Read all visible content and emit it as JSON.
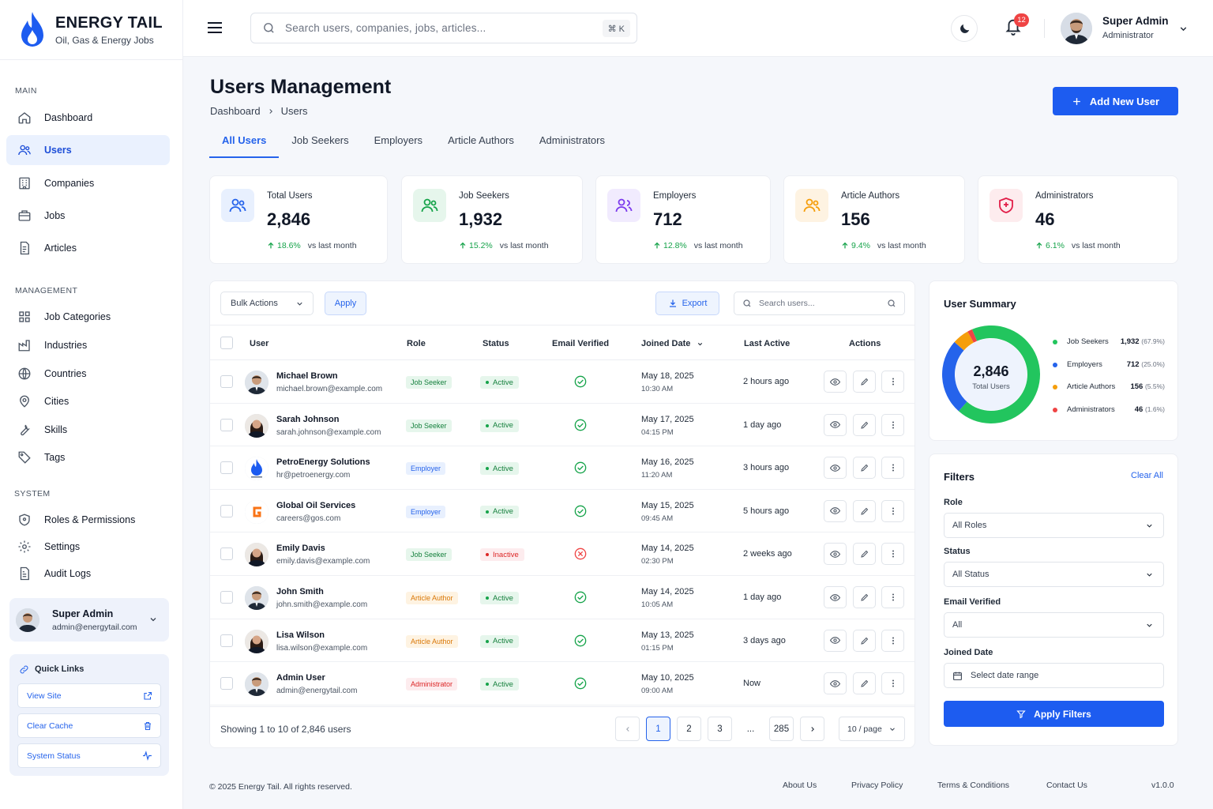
{
  "brand": {
    "title": "ENERGY TAIL",
    "subtitle": "Oil, Gas & Energy Jobs"
  },
  "sidebar": {
    "sections": {
      "main": "MAIN",
      "management": "MANAGEMENT",
      "system": "SYSTEM"
    },
    "main_items": [
      {
        "label": "Dashboard",
        "icon": "home-icon"
      },
      {
        "label": "Users",
        "icon": "users-icon"
      },
      {
        "label": "Companies",
        "icon": "building-icon"
      },
      {
        "label": "Jobs",
        "icon": "briefcase-icon"
      },
      {
        "label": "Articles",
        "icon": "document-icon"
      }
    ],
    "management_items": [
      {
        "label": "Job Categories",
        "icon": "grid-icon"
      },
      {
        "label": "Industries",
        "icon": "factory-icon"
      },
      {
        "label": "Countries",
        "icon": "globe-icon"
      },
      {
        "label": "Cities",
        "icon": "map-pin-icon"
      },
      {
        "label": "Skills",
        "icon": "wrench-icon"
      },
      {
        "label": "Tags",
        "icon": "tag-icon"
      }
    ],
    "system_items": [
      {
        "label": "Roles & Permissions",
        "icon": "shield-icon"
      },
      {
        "label": "Settings",
        "icon": "gear-icon"
      },
      {
        "label": "Audit Logs",
        "icon": "log-icon"
      }
    ],
    "user": {
      "name": "Super Admin",
      "email": "admin@energytail.com"
    },
    "quick_links": {
      "title": "Quick Links",
      "items": [
        {
          "label": "View Site",
          "icon": "external-link-icon"
        },
        {
          "label": "Clear Cache",
          "icon": "trash-icon"
        },
        {
          "label": "System Status",
          "icon": "activity-icon"
        }
      ]
    }
  },
  "topbar": {
    "search_placeholder": "Search users, companies, jobs, articles...",
    "shortcut": "⌘ K",
    "notifications": "12",
    "user_name": "Super Admin",
    "user_role": "Administrator"
  },
  "page": {
    "title": "Users Management",
    "breadcrumb": [
      "Dashboard",
      "Users"
    ],
    "add_button": "Add New User",
    "tabs": [
      "All Users",
      "Job Seekers",
      "Employers",
      "Article Authors",
      "Administrators"
    ]
  },
  "stats": [
    {
      "label": "Total Users",
      "value": "2,846",
      "change": "18.6%",
      "suffix": "vs last month",
      "color": "#2563eb",
      "bg": "#e8f0fe"
    },
    {
      "label": "Job Seekers",
      "value": "1,932",
      "change": "15.2%",
      "suffix": "vs last month",
      "color": "#16a34a",
      "bg": "#e6f6ec"
    },
    {
      "label": "Employers",
      "value": "712",
      "change": "12.8%",
      "suffix": "vs last month",
      "color": "#7c3aed",
      "bg": "#f1ebfe"
    },
    {
      "label": "Article Authors",
      "value": "156",
      "change": "9.4%",
      "suffix": "vs last month",
      "color": "#f59e0b",
      "bg": "#fef3e2"
    },
    {
      "label": "Administrators",
      "value": "46",
      "change": "6.1%",
      "suffix": "vs last month",
      "color": "#e11d48",
      "bg": "#fdecee"
    }
  ],
  "table": {
    "bulk_label": "Bulk Actions",
    "apply_label": "Apply",
    "export_label": "Export",
    "search_placeholder": "Search users...",
    "columns": [
      "User",
      "Role",
      "Status",
      "Email Verified",
      "Joined Date",
      "Last Active",
      "Actions"
    ],
    "rows": [
      {
        "name": "Michael Brown",
        "email": "michael.brown@example.com",
        "role": "Job Seeker",
        "status": "Active",
        "verified": true,
        "date": "May 18, 2025",
        "time": "10:30 AM",
        "last": "2 hours ago",
        "avatar": "male"
      },
      {
        "name": "Sarah Johnson",
        "email": "sarah.johnson@example.com",
        "role": "Job Seeker",
        "status": "Active",
        "verified": true,
        "date": "May 17, 2025",
        "time": "04:15 PM",
        "last": "1 day ago",
        "avatar": "female"
      },
      {
        "name": "PetroEnergy Solutions",
        "email": "hr@petroenergy.com",
        "role": "Employer",
        "status": "Active",
        "verified": true,
        "date": "May 16, 2025",
        "time": "11:20 AM",
        "last": "3 hours ago",
        "avatar": "flame-logo"
      },
      {
        "name": "Global Oil Services",
        "email": "careers@gos.com",
        "role": "Employer",
        "status": "Active",
        "verified": true,
        "date": "May 15, 2025",
        "time": "09:45 AM",
        "last": "5 hours ago",
        "avatar": "g-logo"
      },
      {
        "name": "Emily Davis",
        "email": "emily.davis@example.com",
        "role": "Job Seeker",
        "status": "Inactive",
        "verified": false,
        "date": "May 14, 2025",
        "time": "02:30 PM",
        "last": "2 weeks ago",
        "avatar": "female"
      },
      {
        "name": "John Smith",
        "email": "john.smith@example.com",
        "role": "Article Author",
        "status": "Active",
        "verified": true,
        "date": "May 14, 2025",
        "time": "10:05 AM",
        "last": "1 day ago",
        "avatar": "male"
      },
      {
        "name": "Lisa Wilson",
        "email": "lisa.wilson@example.com",
        "role": "Article Author",
        "status": "Active",
        "verified": true,
        "date": "May 13, 2025",
        "time": "01:15 PM",
        "last": "3 days ago",
        "avatar": "female"
      },
      {
        "name": "Admin User",
        "email": "admin@energytail.com",
        "role": "Administrator",
        "status": "Active",
        "verified": true,
        "date": "May 10, 2025",
        "time": "09:00 AM",
        "last": "Now",
        "avatar": "male"
      }
    ],
    "showing": "Showing 1 to 10 of 2,846 users",
    "pages": [
      "1",
      "2",
      "3",
      "...",
      "285"
    ],
    "per_page": "10 / page"
  },
  "summary": {
    "title": "User Summary",
    "total": "2,846",
    "total_label": "Total Users",
    "items": [
      {
        "label": "Job Seekers",
        "value": "1,932",
        "pct": "(67.9%)",
        "share": 67.9,
        "color": "#22c55e"
      },
      {
        "label": "Employers",
        "value": "712",
        "pct": "(25.0%)",
        "share": 25.0,
        "color": "#2563eb"
      },
      {
        "label": "Article Authors",
        "value": "156",
        "pct": "(5.5%)",
        "share": 5.5,
        "color": "#f59e0b"
      },
      {
        "label": "Administrators",
        "value": "46",
        "pct": "(1.6%)",
        "share": 1.6,
        "color": "#ef4444"
      }
    ]
  },
  "filters": {
    "title": "Filters",
    "clear": "Clear All",
    "role_label": "Role",
    "role_value": "All Roles",
    "status_label": "Status",
    "status_value": "All Status",
    "email_label": "Email Verified",
    "email_value": "All",
    "date_label": "Joined Date",
    "date_placeholder": "Select date range",
    "apply": "Apply Filters"
  },
  "footer": {
    "copyright": "© 2025 Energy Tail. All rights reserved.",
    "links": [
      "About Us",
      "Privacy Policy",
      "Terms & Conditions",
      "Contact Us"
    ],
    "version": "v1.0.0"
  }
}
